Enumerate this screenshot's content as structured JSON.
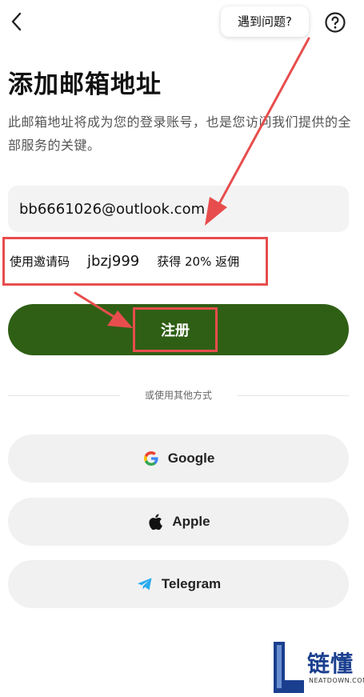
{
  "header": {
    "back_icon": "chevron-left-icon",
    "help_tooltip": "遇到问题?",
    "help_icon": "question-circle-icon"
  },
  "title": "添加邮箱地址",
  "subtitle": "此邮箱地址将成为您的登录账号，也是您访问我们提供的全部服务的关键。",
  "email": {
    "value": "bb6661026@outlook.com"
  },
  "invite": {
    "label": "使用邀请码",
    "code": "jbzj999",
    "reward": "获得 20% 返佣"
  },
  "register": {
    "label": "注册"
  },
  "divider": {
    "text": "或使用其他方式"
  },
  "social": [
    {
      "label": "Google",
      "icon": "google-icon"
    },
    {
      "label": "Apple",
      "icon": "apple-icon"
    },
    {
      "label": "Telegram",
      "icon": "telegram-icon"
    }
  ],
  "watermark": {
    "brand": "链懂",
    "domain": "NEATDOWN.COM"
  },
  "colors": {
    "primary": "#2f5f15",
    "annotation_red": "#e84d4d",
    "field_bg": "#f3f3f3"
  }
}
